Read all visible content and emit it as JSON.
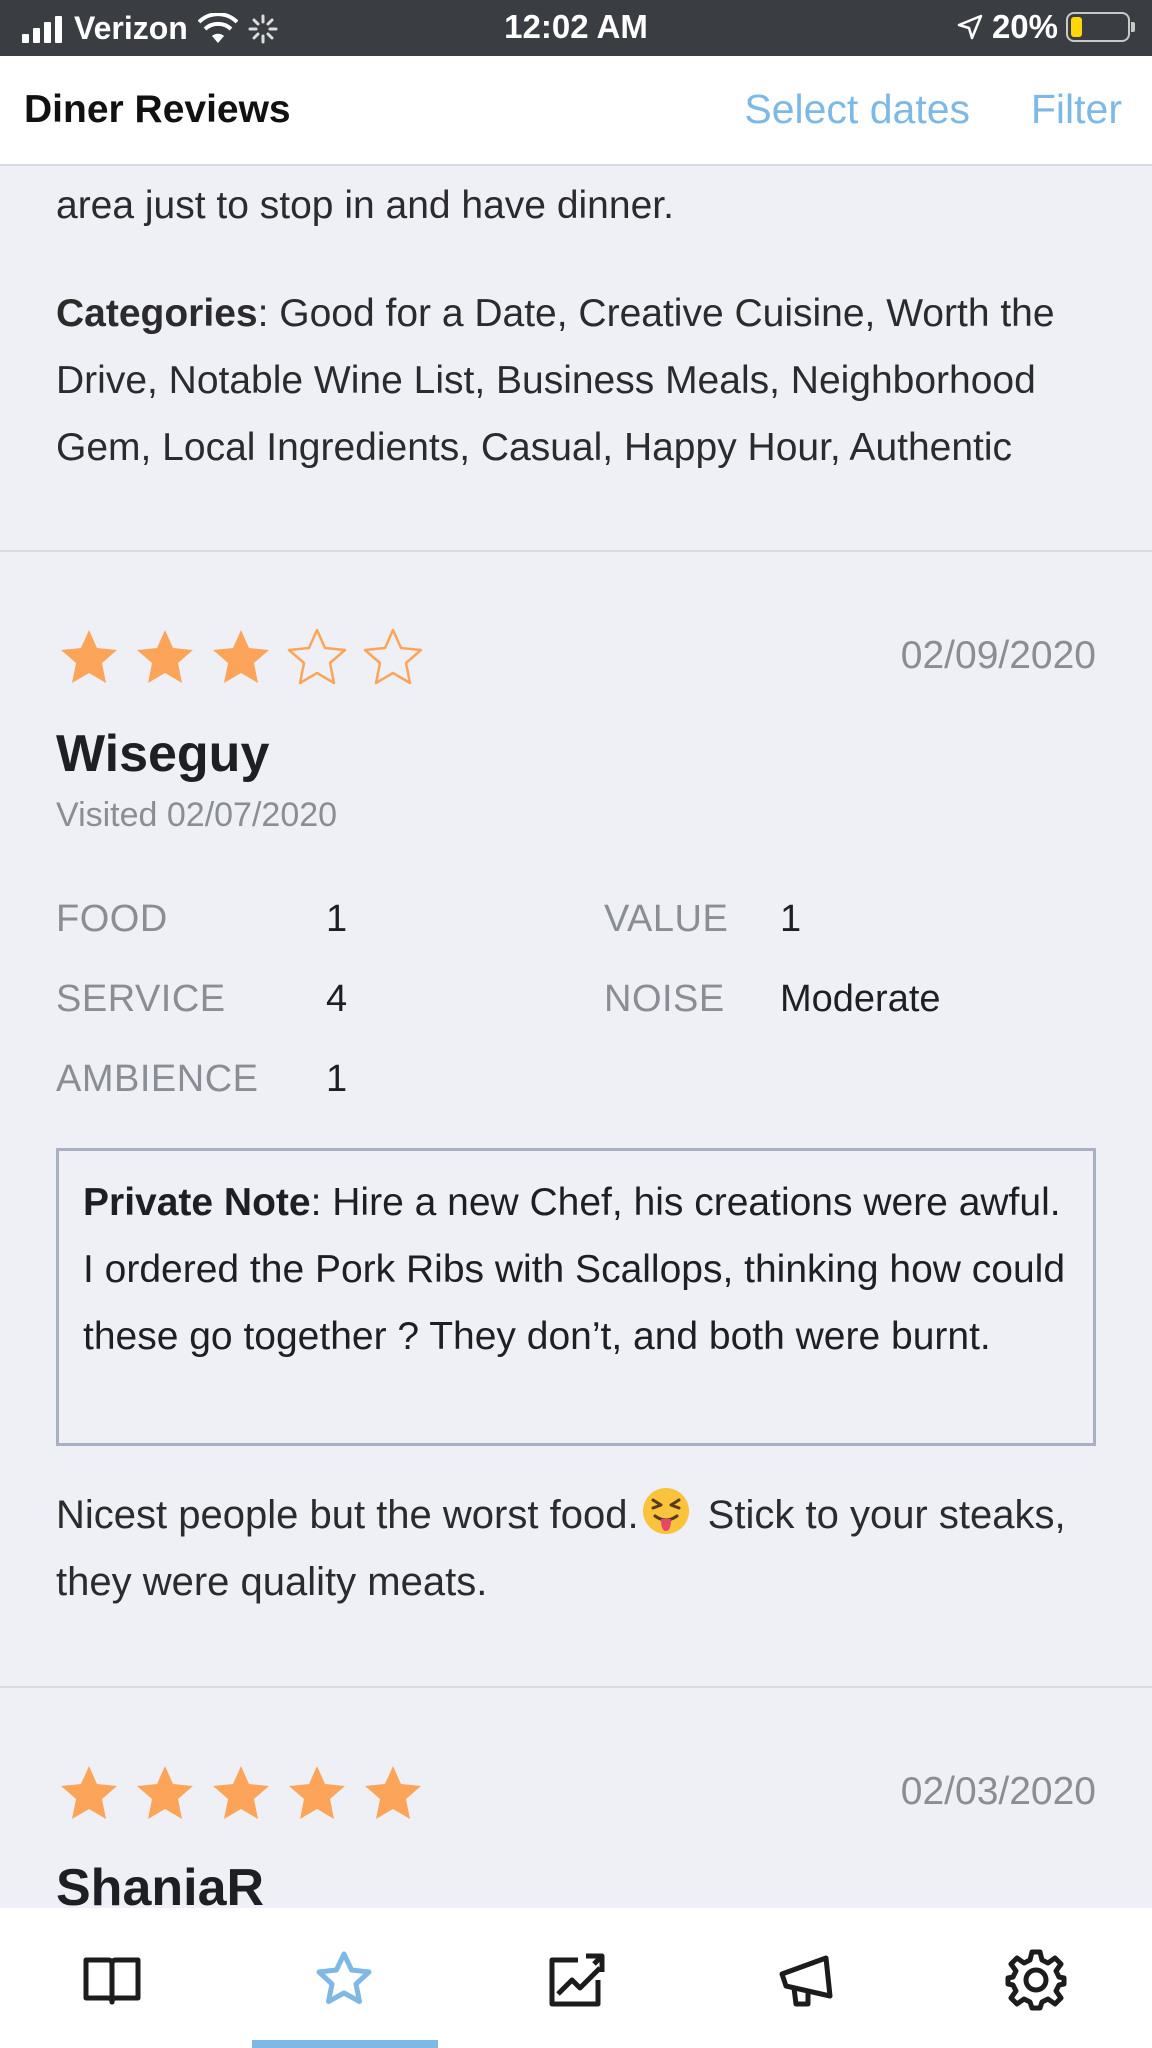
{
  "status_bar": {
    "carrier": "Verizon",
    "time": "12:02 AM",
    "battery": "20%",
    "battery_level": 0.2
  },
  "header": {
    "title": "Diner Reviews",
    "select_dates": "Select dates",
    "filter": "Filter"
  },
  "prev_review": {
    "text_tail": "area just to stop in and have dinner.",
    "categories_label": "Categories",
    "categories": ": Good for a Date, Creative Cuisine, Worth the Drive, Notable Wine List, Business Meals, Neighborhood Gem, Local Ingredients, Casual, Happy Hour, Authentic"
  },
  "reviews": [
    {
      "stars": 3,
      "date": "02/09/2020",
      "name": "Wiseguy",
      "visited": "Visited 02/07/2020",
      "ratings": {
        "food_label": "FOOD",
        "food": "1",
        "service_label": "SERVICE",
        "service": "4",
        "ambience_label": "AMBIENCE",
        "ambience": "1",
        "value_label": "VALUE",
        "value": "1",
        "noise_label": "NOISE",
        "noise": "Moderate"
      },
      "private_note_label": "Private Note",
      "private_note": ": Hire a new Chef, his creations were awful. I ordered the Pork Ribs with Scallops, thinking how could these go together ? They don’t, and both were burnt.",
      "comment_before": "Nicest people but the worst food.",
      "comment_after": " Stick to your steaks, they were quality meats."
    },
    {
      "stars": 5,
      "date": "02/03/2020",
      "name": "ShaniaR"
    }
  ],
  "tabs": [
    "book-icon",
    "star-icon",
    "trending-icon",
    "megaphone-icon",
    "gear-icon"
  ],
  "colors": {
    "accent": "#7eb9e6",
    "star": "#fca55a",
    "background": "#eef0f5"
  }
}
